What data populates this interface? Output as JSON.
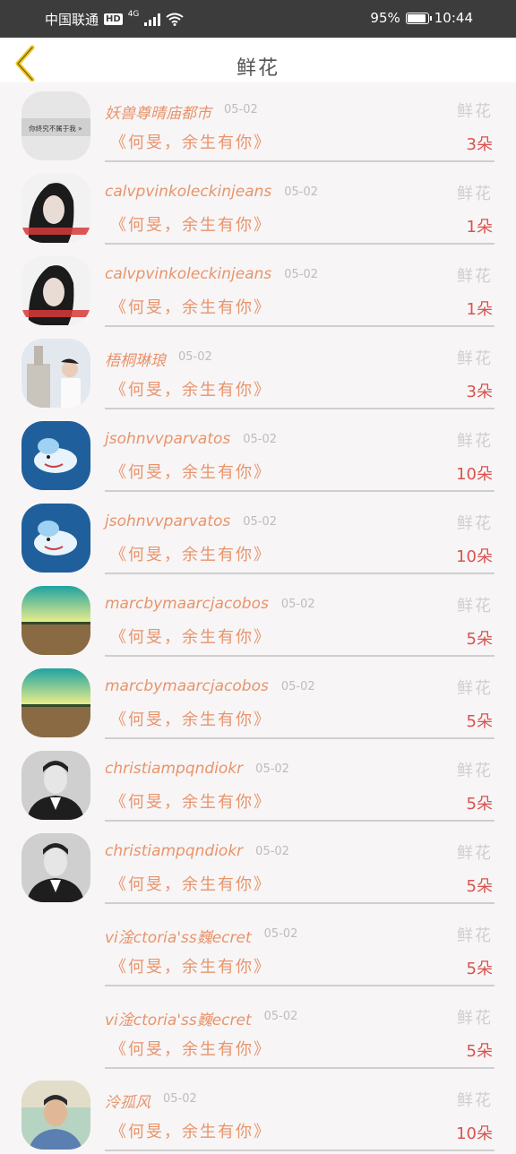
{
  "status_bar": {
    "carrier": "中国联通",
    "hd": "HD",
    "network": "4G",
    "battery_text": "95%",
    "battery_level": 0.95,
    "time": "10:44"
  },
  "header": {
    "title": "鲜花",
    "back_icon": "chevron-left-icon",
    "accent_color": "#f0c419"
  },
  "rows": [
    {
      "name": "妖兽尊晴庙都市",
      "date": "05-02",
      "gift": "鲜花",
      "song": "《何旻，余生有你》",
      "count": "3朵",
      "avatar": "mono-text",
      "avatar_text": "你终究不属于我 »"
    },
    {
      "name": "calvpvinkoleckinjeans",
      "date": "05-02",
      "gift": "鲜花",
      "song": "《何旻，余生有你》",
      "count": "1朵",
      "avatar": "portrait-woman"
    },
    {
      "name": "calvpvinkoleckinjeans",
      "date": "05-02",
      "gift": "鲜花",
      "song": "《何旻，余生有你》",
      "count": "1朵",
      "avatar": "portrait-woman"
    },
    {
      "name": "梧桐琳琅",
      "date": "05-02",
      "gift": "鲜花",
      "song": "《何旻，余生有你》",
      "count": "3朵",
      "avatar": "man-building"
    },
    {
      "name": "jsohnvvparvatos",
      "date": "05-02",
      "gift": "鲜花",
      "song": "《何旻，余生有你》",
      "count": "10朵",
      "avatar": "whale"
    },
    {
      "name": "jsohnvvparvatos",
      "date": "05-02",
      "gift": "鲜花",
      "song": "《何旻，余生有你》",
      "count": "10朵",
      "avatar": "whale"
    },
    {
      "name": "marcbymaarcjacobos",
      "date": "05-02",
      "gift": "鲜花",
      "song": "《何旻，余生有你》",
      "count": "5朵",
      "avatar": "field"
    },
    {
      "name": "marcbymaarcjacobos",
      "date": "05-02",
      "gift": "鲜花",
      "song": "《何旻，余生有你》",
      "count": "5朵",
      "avatar": "field"
    },
    {
      "name": "christiampqndiokr",
      "date": "05-02",
      "gift": "鲜花",
      "song": "《何旻，余生有你》",
      "count": "5朵",
      "avatar": "man-suit"
    },
    {
      "name": "christiampqndiokr",
      "date": "05-02",
      "gift": "鲜花",
      "song": "《何旻，余生有你》",
      "count": "5朵",
      "avatar": "man-suit"
    },
    {
      "name": "vi淦ctoria'ss巍ecret",
      "date": "05-02",
      "gift": "鲜花",
      "song": "《何旻，余生有你》",
      "count": "5朵",
      "avatar": "none"
    },
    {
      "name": "vi淦ctoria'ss巍ecret",
      "date": "05-02",
      "gift": "鲜花",
      "song": "《何旻，余生有你》",
      "count": "5朵",
      "avatar": "none"
    },
    {
      "name": "泠孤风",
      "date": "05-02",
      "gift": "鲜花",
      "song": "《何旻，余生有你》",
      "count": "10朵",
      "avatar": "man-outdoor"
    }
  ]
}
